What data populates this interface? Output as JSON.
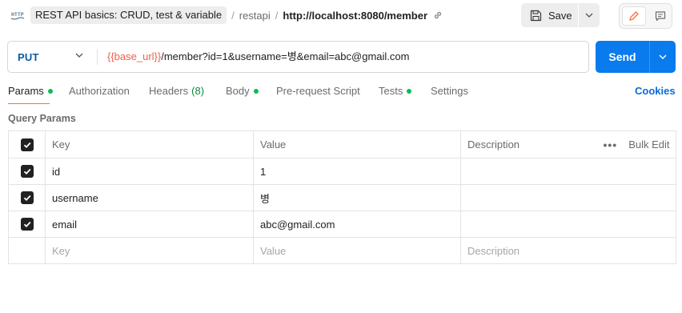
{
  "header": {
    "breadcrumb": {
      "collection": "REST API basics: CRUD, test & variable",
      "sep1": "/",
      "folder": "restapi",
      "sep2": "/",
      "request": "http://localhost:8080/member"
    },
    "save_label": "Save",
    "icons": {
      "request_type": "http-icon",
      "link": "link-icon",
      "save": "floppy-disk-icon",
      "edit": "pencil-icon",
      "comments": "comment-icon"
    }
  },
  "request": {
    "method": "PUT",
    "url_variable": "{{base_url}}",
    "url_rest": "/member?id=1&username=병&email=abc@gmail.com",
    "send_label": "Send"
  },
  "tabs": [
    {
      "label": "Params",
      "dot": true,
      "active": true
    },
    {
      "label": "Authorization"
    },
    {
      "label": "Headers",
      "count": "(8)"
    },
    {
      "label": "Body",
      "dot": true
    },
    {
      "label": "Pre-request Script"
    },
    {
      "label": "Tests",
      "dot": true
    },
    {
      "label": "Settings"
    }
  ],
  "cookies_label": "Cookies",
  "query_params": {
    "title": "Query Params",
    "columns": {
      "key": "Key",
      "value": "Value",
      "description": "Description",
      "bulk_edit": "Bulk Edit",
      "more": "•••"
    },
    "rows": [
      {
        "key": "id",
        "value": "1",
        "description": "",
        "checked": true
      },
      {
        "key": "username",
        "value": "병",
        "description": "",
        "checked": true
      },
      {
        "key": "email",
        "value": "abc@gmail.com",
        "description": "",
        "checked": true
      }
    ],
    "placeholder": {
      "key": "Key",
      "value": "Value",
      "description": "Description"
    }
  },
  "colors": {
    "accent_orange": "#ff6c37",
    "send_blue": "#097bed",
    "method_blue": "#0a5ba8",
    "variable_orange": "#e8634a",
    "status_green": "#0cbb52"
  }
}
